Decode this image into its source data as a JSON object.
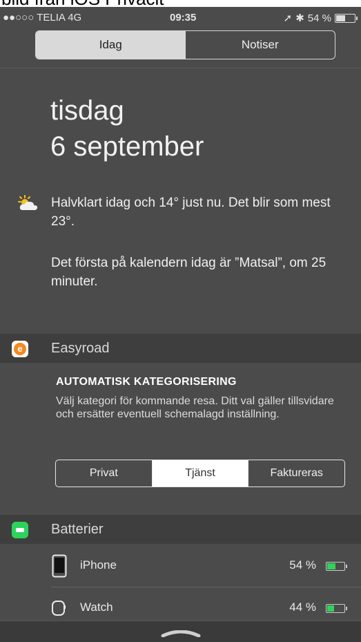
{
  "caption": "bild från iOS Privacit",
  "status": {
    "carrier": "●●○○○ TELIA  4G",
    "time": "09:35",
    "battery": "54 %",
    "battery_level": 0.54
  },
  "tabs": [
    {
      "label": "Idag",
      "active": true
    },
    {
      "label": "Notiser",
      "active": false
    }
  ],
  "date": {
    "weekday": "tisdag",
    "day": "6 september"
  },
  "summary": {
    "weather": "Halvklart idag och 14° just nu. Det blir som mest 23°.",
    "calendar": "Det första på kalendern idag är ”Matsal”, om 25 minuter."
  },
  "easyroad": {
    "app_name": "Easyroad",
    "title": "AUTOMATISK KATEGORISERING",
    "description": "Välj kategori för kommande resa. Ditt val gäller tillsvidare och ersätter eventuell schemalagd inställning.",
    "options": [
      {
        "label": "Privat",
        "active": false
      },
      {
        "label": "Tjänst",
        "active": true
      },
      {
        "label": "Faktureras",
        "active": false
      }
    ],
    "accent_color": "#f28a1f"
  },
  "batteries": {
    "title": "Batterier",
    "accent_color": "#2dd35b",
    "devices": [
      {
        "name": "iPhone",
        "percent": "54 %",
        "level": 0.54,
        "icon": "iphone-icon"
      },
      {
        "name": "Watch",
        "percent": "44 %",
        "level": 0.44,
        "icon": "watch-icon"
      }
    ]
  }
}
